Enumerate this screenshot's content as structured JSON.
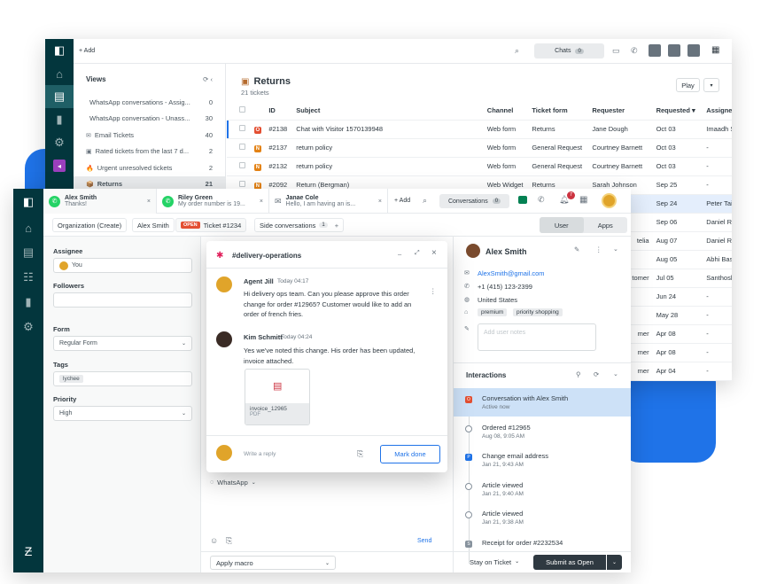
{
  "colors": {
    "brand_dark": "#03363d",
    "accent_blue": "#1f73e8",
    "open_red": "#e34f32",
    "new_orange": "#e38215",
    "pending_blue": "#1f73e8",
    "solved_gray": "#87929d",
    "whatsapp": "#25d366"
  },
  "back": {
    "topbar": {
      "add_label": "+ Add",
      "chats_label": "Chats",
      "chats_count": "0"
    },
    "views": {
      "title": "Views",
      "items": [
        {
          "label": "WhatsApp conversations - Assig...",
          "count": "0",
          "icon": ""
        },
        {
          "label": "WhatsApp conversation - Unass...",
          "count": "30",
          "icon": ""
        },
        {
          "label": "Email Tickets",
          "count": "40",
          "icon": "✉"
        },
        {
          "label": "Rated tickets from the last 7 d...",
          "count": "2",
          "icon": "▣"
        },
        {
          "label": "Urgent unresolved tickets",
          "count": "2",
          "icon": "🔥"
        },
        {
          "label": "Returns",
          "count": "21",
          "icon": "📦"
        }
      ]
    },
    "main": {
      "title": "Returns",
      "subtitle": "21 tickets",
      "play_label": "Play",
      "columns": [
        "ID",
        "Subject",
        "Channel",
        "Ticket form",
        "Requester",
        "Requested ▾",
        "Assignee"
      ],
      "rows": [
        {
          "status": "O",
          "id": "#2138",
          "subject": "Chat with Visitor 1570139948",
          "channel": "Web form",
          "form": "Returns",
          "requester": "Jane Dough",
          "requested": "Oct 03",
          "assignee": "Imaadh S"
        },
        {
          "status": "N",
          "id": "#2137",
          "subject": "return policy",
          "channel": "Web form",
          "form": "General Request",
          "requester": "Courtney Barnett",
          "requested": "Oct 03",
          "assignee": "-"
        },
        {
          "status": "N",
          "id": "#2132",
          "subject": "return policy",
          "channel": "Web form",
          "form": "General Request",
          "requester": "Courtney Barnett",
          "requested": "Oct 03",
          "assignee": "-"
        },
        {
          "status": "N",
          "id": "#2092",
          "subject": "Return (Bergman)",
          "channel": "Web Widget",
          "form": "Returns",
          "requester": "Sarah Johnson",
          "requested": "Sep 25",
          "assignee": "-"
        }
      ],
      "peek_rows": [
        {
          "requester": "",
          "requested": "Sep 24",
          "assignee": "Peter Tai"
        },
        {
          "requester": "",
          "requested": "Sep 06",
          "assignee": "Daniel Ru"
        },
        {
          "requester": "telia",
          "requested": "Aug 07",
          "assignee": "Daniel Ru"
        },
        {
          "requester": "",
          "requested": "Aug 05",
          "assignee": "Abhi Bas"
        },
        {
          "requester": "tomer",
          "requested": "Jul 05",
          "assignee": "Santhosh"
        },
        {
          "requester": "",
          "requested": "Jun 24",
          "assignee": "-"
        },
        {
          "requester": "",
          "requested": "May 28",
          "assignee": "-"
        },
        {
          "requester": "mer",
          "requested": "Apr 08",
          "assignee": "-"
        },
        {
          "requester": "mer",
          "requested": "Apr 08",
          "assignee": "-"
        },
        {
          "requester": "mer",
          "requested": "Apr 04",
          "assignee": "-"
        }
      ]
    }
  },
  "front": {
    "tabs": [
      {
        "name": "Alex Smith",
        "preview": "Thanks!"
      },
      {
        "name": "Riley Green",
        "preview": "My order number is 19..."
      },
      {
        "name": "Janae Cole",
        "preview": "Hello, I am having an is..."
      }
    ],
    "add_label": "+ Add",
    "conversations_label": "Conversations",
    "conversations_count": "0",
    "notif_count": "7",
    "subbar": {
      "org": "Organization (Create)",
      "user": "Alex Smith",
      "open_badge": "OPEN",
      "ticket": "Ticket #1234",
      "side_conv": "Side conversations",
      "side_count": "1",
      "user_tab": "User",
      "apps_tab": "Apps"
    },
    "props": {
      "assignee_label": "Assignee",
      "assignee_value": "You",
      "followers_label": "Followers",
      "form_label": "Form",
      "form_value": "Regular Form",
      "tags_label": "Tags",
      "tag": "lychee",
      "priority_label": "Priority",
      "priority_value": "High"
    },
    "conv": {
      "channel": "WhatsApp",
      "send": "Send"
    },
    "bottom": {
      "macro": "Apply macro",
      "stay": "Stay on Ticket",
      "submit": "Submit as Open"
    },
    "side": {
      "name": "Alex Smith",
      "email": "AlexSmith@gmail.com",
      "phone": "+1 (415) 123-2399",
      "location": "United States",
      "tags": [
        "premium",
        "priority shopping"
      ],
      "notes_placeholder": "Add user notes",
      "interactions_title": "Interactions",
      "items": [
        {
          "title": "Conversation with Alex Smith",
          "sub": "Active now"
        },
        {
          "title": "Ordered #12965",
          "sub": "Aug 08, 9:05 AM"
        },
        {
          "title": "Change email address",
          "sub": "Jan 21, 9:43 AM"
        },
        {
          "title": "Article viewed",
          "sub": "Jan 21, 9:40 AM"
        },
        {
          "title": "Article viewed",
          "sub": "Jan 21, 9:38 AM"
        },
        {
          "title": "Receipt for order #2232534",
          "sub": ""
        }
      ]
    }
  },
  "slack": {
    "channel": "#delivery-operations",
    "messages": [
      {
        "author": "Agent Jill",
        "time": "Today 04:17",
        "text": "Hi delivery ops team. Can you please approve this order change for order #12965? Customer would like to add an order of french fries."
      },
      {
        "author": "Kim Schmitt",
        "time": "Today 04:24",
        "text": "Yes we've noted this change. His order has been updated, invoice attached."
      }
    ],
    "file_name": "invoice_12965",
    "file_type": "PDF",
    "reply_placeholder": "Write a reply",
    "mark_done": "Mark done"
  }
}
